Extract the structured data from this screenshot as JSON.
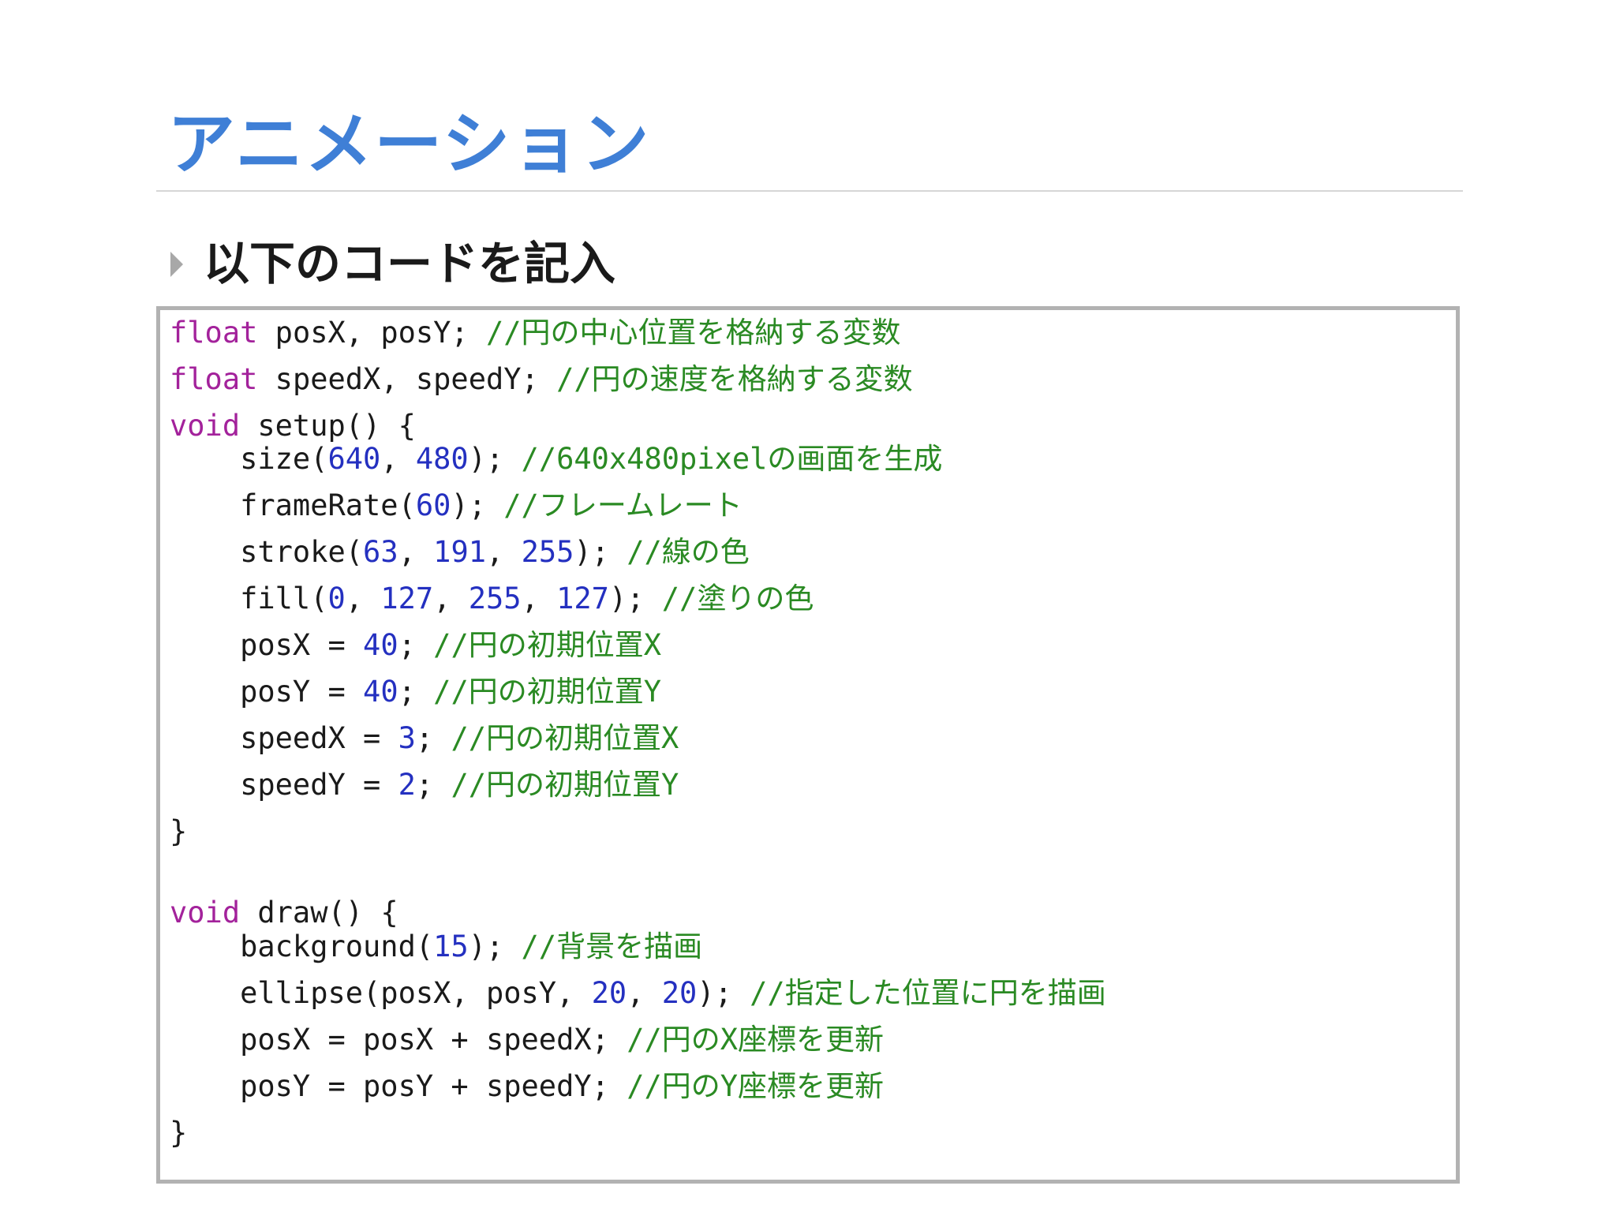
{
  "slide": {
    "title": "アニメーション",
    "bullet": "以下のコードを記入"
  },
  "code": {
    "lines": [
      [
        {
          "t": "float",
          "c": "kw"
        },
        {
          "t": " posX, posY; ",
          "c": "pl"
        },
        {
          "t": "//円の中心位置を格納する変数",
          "c": "cm"
        }
      ],
      [
        {
          "t": "float",
          "c": "kw"
        },
        {
          "t": " speedX, speedY; ",
          "c": "pl"
        },
        {
          "t": "//円の速度を格納する変数",
          "c": "cm"
        }
      ],
      [
        {
          "t": "void",
          "c": "kw"
        },
        {
          "t": " setup() {",
          "c": "pl"
        }
      ],
      [
        {
          "t": "    size(",
          "c": "pl"
        },
        {
          "t": "640",
          "c": "num"
        },
        {
          "t": ", ",
          "c": "pl"
        },
        {
          "t": "480",
          "c": "num"
        },
        {
          "t": "); ",
          "c": "pl"
        },
        {
          "t": "//640x480pixelの画面を生成",
          "c": "cm"
        }
      ],
      [
        {
          "t": "    frameRate(",
          "c": "pl"
        },
        {
          "t": "60",
          "c": "num"
        },
        {
          "t": "); ",
          "c": "pl"
        },
        {
          "t": "//フレームレート",
          "c": "cm"
        }
      ],
      [
        {
          "t": "    stroke(",
          "c": "pl"
        },
        {
          "t": "63",
          "c": "num"
        },
        {
          "t": ", ",
          "c": "pl"
        },
        {
          "t": "191",
          "c": "num"
        },
        {
          "t": ", ",
          "c": "pl"
        },
        {
          "t": "255",
          "c": "num"
        },
        {
          "t": "); ",
          "c": "pl"
        },
        {
          "t": "//線の色",
          "c": "cm"
        }
      ],
      [
        {
          "t": "    fill(",
          "c": "pl"
        },
        {
          "t": "0",
          "c": "num"
        },
        {
          "t": ", ",
          "c": "pl"
        },
        {
          "t": "127",
          "c": "num"
        },
        {
          "t": ", ",
          "c": "pl"
        },
        {
          "t": "255",
          "c": "num"
        },
        {
          "t": ", ",
          "c": "pl"
        },
        {
          "t": "127",
          "c": "num"
        },
        {
          "t": "); ",
          "c": "pl"
        },
        {
          "t": "//塗りの色",
          "c": "cm"
        }
      ],
      [
        {
          "t": "    posX = ",
          "c": "pl"
        },
        {
          "t": "40",
          "c": "num"
        },
        {
          "t": "; ",
          "c": "pl"
        },
        {
          "t": "//円の初期位置X",
          "c": "cm"
        }
      ],
      [
        {
          "t": "    posY = ",
          "c": "pl"
        },
        {
          "t": "40",
          "c": "num"
        },
        {
          "t": "; ",
          "c": "pl"
        },
        {
          "t": "//円の初期位置Y",
          "c": "cm"
        }
      ],
      [
        {
          "t": "    speedX = ",
          "c": "pl"
        },
        {
          "t": "3",
          "c": "num"
        },
        {
          "t": "; ",
          "c": "pl"
        },
        {
          "t": "//円の初期位置X",
          "c": "cm"
        }
      ],
      [
        {
          "t": "    speedY = ",
          "c": "pl"
        },
        {
          "t": "2",
          "c": "num"
        },
        {
          "t": "; ",
          "c": "pl"
        },
        {
          "t": "//円の初期位置Y",
          "c": "cm"
        }
      ],
      [
        {
          "t": "}",
          "c": "pl"
        }
      ],
      [
        {
          "t": "void",
          "c": "kw"
        },
        {
          "t": " draw() {",
          "c": "pl"
        }
      ],
      [
        {
          "t": "    background(",
          "c": "pl"
        },
        {
          "t": "15",
          "c": "num"
        },
        {
          "t": "); ",
          "c": "pl"
        },
        {
          "t": "//背景を描画",
          "c": "cm"
        }
      ],
      [
        {
          "t": "    ellipse(posX, posY, ",
          "c": "pl"
        },
        {
          "t": "20",
          "c": "num"
        },
        {
          "t": ", ",
          "c": "pl"
        },
        {
          "t": "20",
          "c": "num"
        },
        {
          "t": "); ",
          "c": "pl"
        },
        {
          "t": "//指定した位置に円を描画",
          "c": "cm"
        }
      ],
      [
        {
          "t": "    posX = posX + speedX; ",
          "c": "pl"
        },
        {
          "t": "//円のX座標を更新",
          "c": "cm"
        }
      ],
      [
        {
          "t": "    posY = posY + speedY; ",
          "c": "pl"
        },
        {
          "t": "//円のY座標を更新",
          "c": "cm"
        }
      ],
      [
        {
          "t": "}",
          "c": "pl"
        }
      ]
    ]
  }
}
